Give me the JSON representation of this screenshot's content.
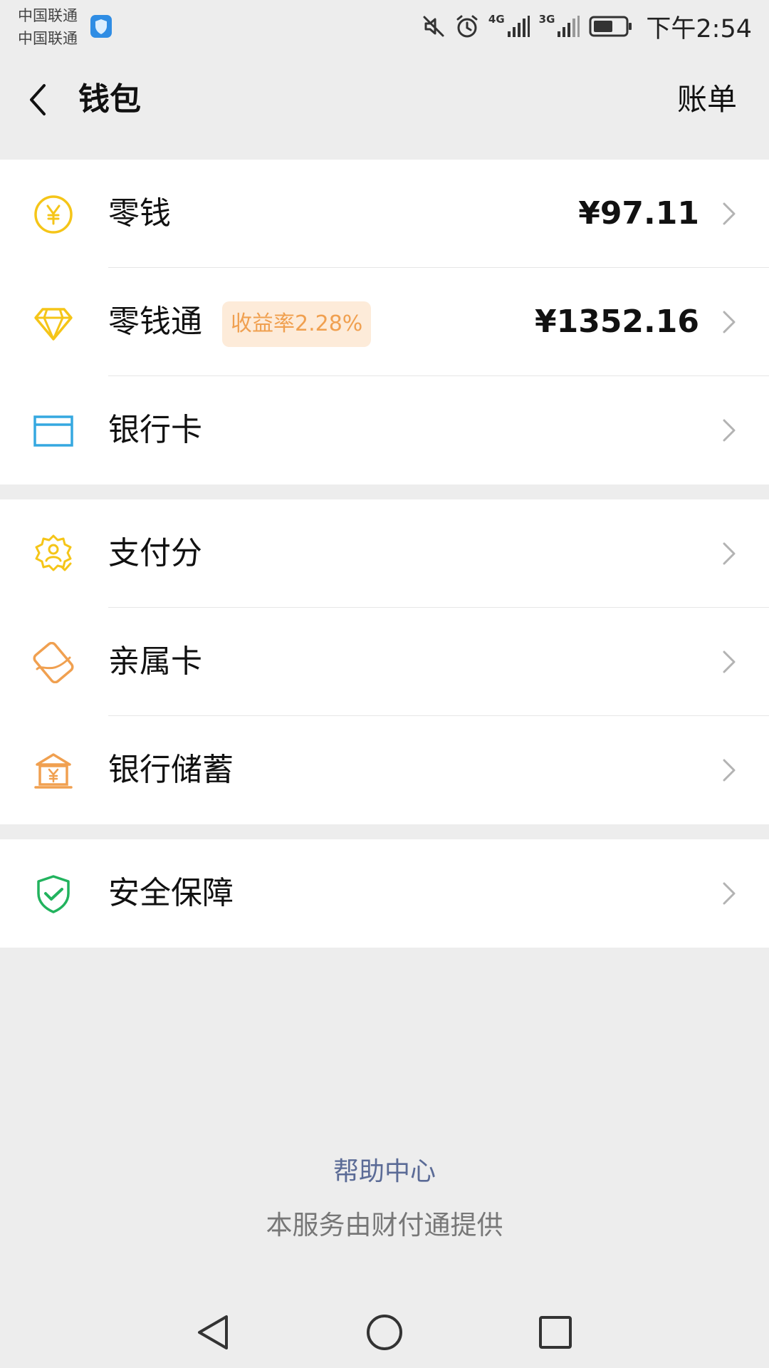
{
  "status_bar": {
    "carrier_line1": "中国联通",
    "carrier_line2": "中国联通",
    "network_1": "4G",
    "network_2": "3G",
    "time": "下午2:54",
    "icons": [
      "shield-icon",
      "mute-icon",
      "alarm-icon",
      "signal-4g-icon",
      "signal-3g-icon",
      "battery-icon"
    ]
  },
  "header": {
    "title": "钱包",
    "right_link": "账单"
  },
  "groups": [
    {
      "rows": [
        {
          "label": "零钱",
          "value": "¥97.11",
          "icon": "yuan-coin-icon"
        },
        {
          "label": "零钱通",
          "badge": "收益率2.28%",
          "value": "¥1352.16",
          "icon": "diamond-icon"
        },
        {
          "label": "银行卡",
          "icon": "bank-card-icon"
        }
      ]
    },
    {
      "rows": [
        {
          "label": "支付分",
          "icon": "pay-score-icon"
        },
        {
          "label": "亲属卡",
          "icon": "family-card-icon"
        },
        {
          "label": "银行储蓄",
          "icon": "bank-savings-icon"
        }
      ]
    },
    {
      "rows": [
        {
          "label": "安全保障",
          "icon": "security-shield-icon"
        }
      ]
    }
  ],
  "footer": {
    "help": "帮助中心",
    "provider": "本服务由财付通提供"
  },
  "colors": {
    "background": "#ededed",
    "card": "#ffffff",
    "yellow": "#f5c518",
    "blue": "#35a8e0",
    "orange": "#f0a050",
    "green": "#22b35e",
    "link": "#5b6b96"
  }
}
